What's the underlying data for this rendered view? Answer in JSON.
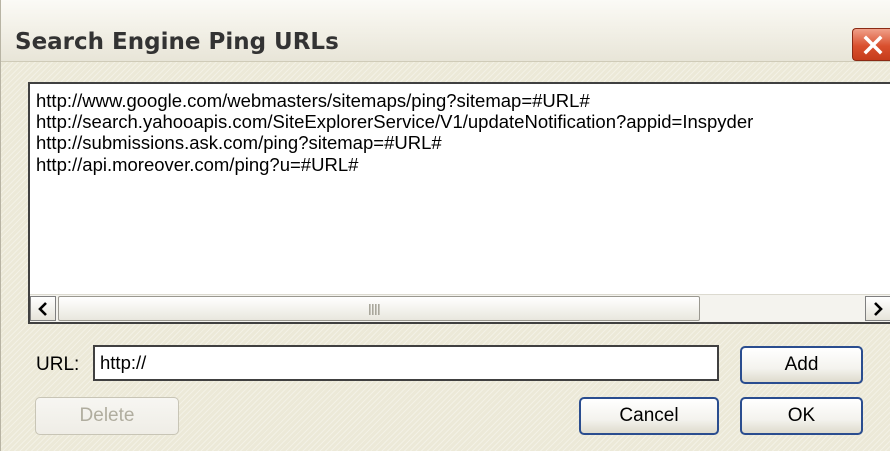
{
  "window": {
    "title": "Search Engine Ping URLs"
  },
  "icons": {
    "close": "close-x-icon",
    "scroll_left": "arrow-left-icon",
    "scroll_right": "arrow-right-icon",
    "scroll_grip": "grip-icon"
  },
  "list": {
    "items": [
      "http://www.google.com/webmasters/sitemaps/ping?sitemap=#URL#",
      "http://search.yahooapis.com/SiteExplorerService/V1/updateNotification?appid=Inspyder",
      "http://submissions.ask.com/ping?sitemap=#URL#",
      "http://api.moreover.com/ping?u=#URL#"
    ]
  },
  "form": {
    "url_label": "URL:",
    "url_value": "http://"
  },
  "buttons": {
    "add": "Add",
    "delete": "Delete",
    "cancel": "Cancel",
    "ok": "OK"
  },
  "colors": {
    "window_bg": "#ece9d8",
    "close_button": "#d9502e",
    "button_border": "#2a4d8f"
  }
}
